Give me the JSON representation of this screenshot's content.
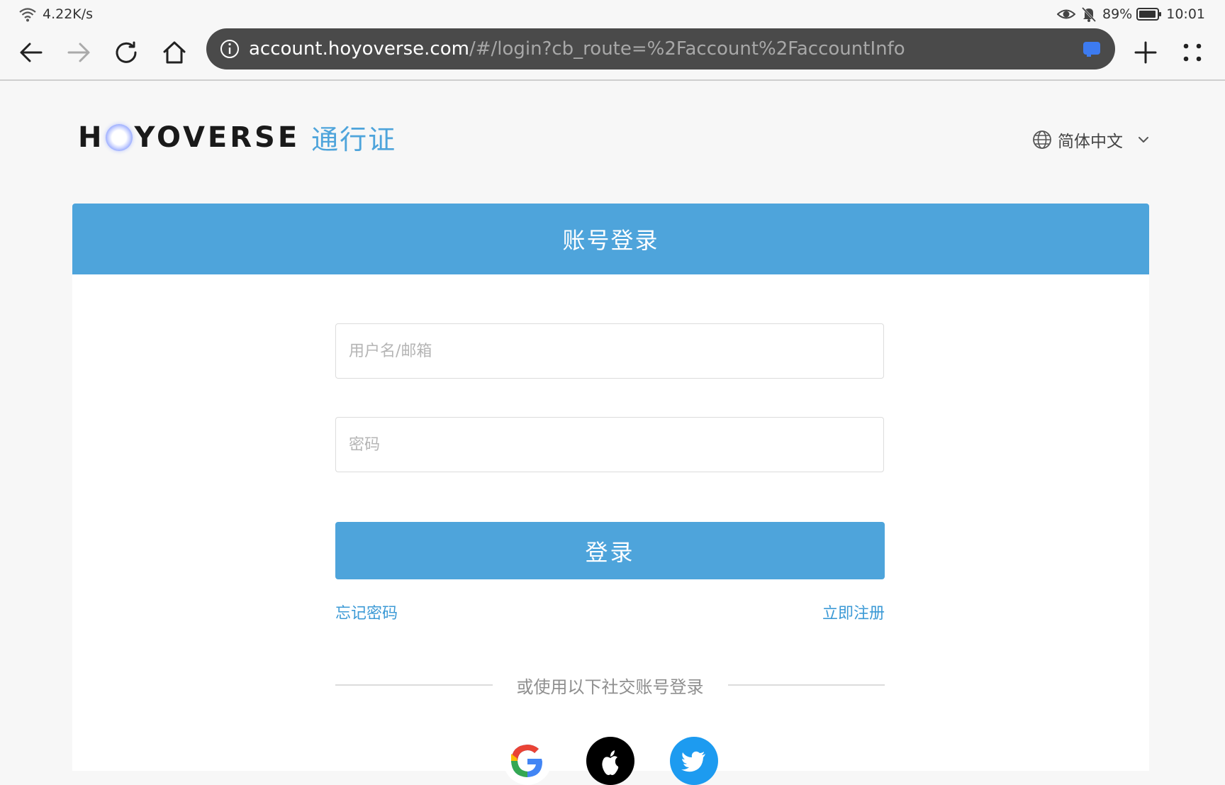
{
  "status_bar": {
    "speed": "4.22K/s",
    "battery": "89%",
    "time": "10:01"
  },
  "browser": {
    "url_host": "account.hoyoverse.com",
    "url_path": "/#/login?cb_route=%2Faccount%2FaccountInfo"
  },
  "header": {
    "logo_word_left": "H",
    "logo_word_right": "YOVERSE",
    "logo_cn": "通行证",
    "language": "简体中文"
  },
  "login": {
    "title": "账号登录",
    "username_placeholder": "用户名/邮箱",
    "password_placeholder": "密码",
    "submit_label": "登录",
    "forgot_label": "忘记密码",
    "register_label": "立即注册",
    "social_divider": "或使用以下社交账号登录"
  },
  "icons": {
    "wifi": "wifi-icon",
    "eye": "eye-icon",
    "bell_off": "bell-off-icon",
    "battery": "battery-icon",
    "back": "back-arrow-icon",
    "forward": "forward-arrow-icon",
    "reload": "reload-icon",
    "home": "home-icon",
    "info": "info-icon",
    "tabs": "tab-icon",
    "new_tab": "plus-icon",
    "menu": "menu-dots-icon",
    "globe": "globe-icon",
    "chevron": "chevron-down-icon",
    "google": "google-icon",
    "apple": "apple-icon",
    "twitter": "twitter-icon"
  },
  "colors": {
    "brand_blue": "#4ea4db",
    "link_blue": "#3c9ad6",
    "urlbar_bg": "#4a4a4a"
  }
}
